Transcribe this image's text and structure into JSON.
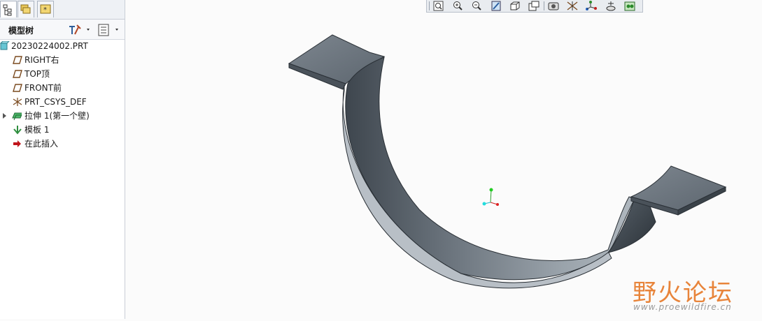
{
  "model_tree": {
    "title": "模型树",
    "items": [
      {
        "label": "20230224002.PRT",
        "icon": "part-icon"
      },
      {
        "label": "RIGHT右",
        "icon": "datum-plane-icon"
      },
      {
        "label": "TOP顶",
        "icon": "datum-plane-icon"
      },
      {
        "label": "FRONT前",
        "icon": "datum-plane-icon"
      },
      {
        "label": "PRT_CSYS_DEF",
        "icon": "coordinate-system-icon"
      },
      {
        "label": "拉伸 1(第一个壁)",
        "icon": "extrude-wall-icon"
      },
      {
        "label": "模板 1",
        "icon": "template-icon"
      },
      {
        "label": "在此插入",
        "icon": "insert-here-arrow-icon"
      }
    ]
  },
  "toolbar": {
    "icons": [
      "refit-icon",
      "zoom-in-icon",
      "zoom-out-icon",
      "repaint-icon",
      "orientation-icon",
      "saved-views-icon",
      "display-style-icon",
      "datum-display-icon",
      "csys-display-icon",
      "spin-center-icon",
      "annotation-display-icon"
    ]
  },
  "watermark": {
    "name": "野火论坛",
    "url": "www.proewildfire.cn"
  },
  "colors": {
    "part_dark": "#4b535c",
    "part_mid": "#7a838c",
    "part_light": "#a7afb7",
    "watermark": "#e8843a"
  }
}
